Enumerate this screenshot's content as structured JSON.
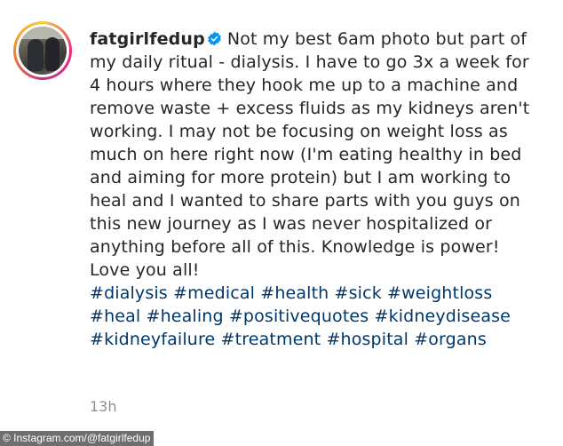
{
  "post": {
    "username": "fatgirlfedup",
    "verified_icon": "verified-badge-icon",
    "caption": "Not my best 6am photo but part of my daily ritual - dialysis. I have to go 3x a week for 4 hours where they hook me up to a machine and remove waste + excess fluids as my kidneys aren't working. I may not be focusing on weight loss as much on here right now (I'm eating healthy in bed and aiming for more protein) but I am working to heal and I wanted to share parts with you guys on this new journey as I was never hospitalized or anything before all of this. Knowledge is power! Love you all!",
    "hashtags": "#dialysis #medical #health #sick #weightloss #heal #healing #positivequotes #kidneydisease #kidneyfailure #treatment #hospital #organs",
    "time": "13h"
  },
  "credit": "© Instagram.com/@fatgirlfedup",
  "colors": {
    "text": "#262626",
    "hashtag": "#00376b",
    "verified": "#0095f6",
    "muted": "#8e8e8e"
  }
}
